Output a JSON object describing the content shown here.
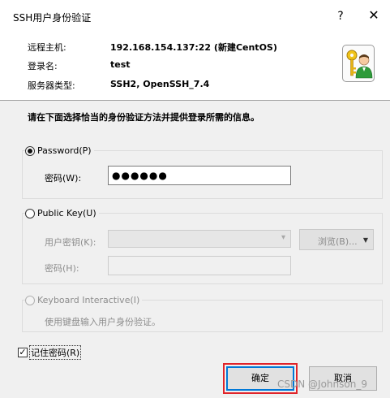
{
  "window": {
    "title": "SSH用户身份验证",
    "help": "?",
    "close": "✕"
  },
  "info": {
    "host_label": "远程主机:",
    "host_value": "192.168.154.137:22 (新建CentOS)",
    "login_label": "登录名:",
    "login_value": "test",
    "server_label": "服务器类型:",
    "server_value": "SSH2, OpenSSH_7.4"
  },
  "instruction": "请在下面选择恰当的身份验证方法并提供登录所需的信息。",
  "password_method": {
    "label": "Password(P)",
    "selected": true,
    "password_label": "密码(W):",
    "password_value": "●●●●●●"
  },
  "publickey_method": {
    "label": "Public Key(U)",
    "selected": false,
    "user_key_label": "用户密钥(K):",
    "user_key_value": "",
    "browse_label": "浏览(B)...",
    "passphrase_label": "密码(H):",
    "passphrase_value": ""
  },
  "keyboard_method": {
    "label": "Keyboard Interactive(I)",
    "selected": false,
    "description": "使用键盘输入用户身份验证。"
  },
  "remember": {
    "label": "记住密码(R)",
    "checked": true
  },
  "buttons": {
    "ok": "确定",
    "cancel": "取消"
  },
  "watermark": "CSDN @Johnson_9",
  "colors": {
    "highlight": "#e0242a",
    "default_button_border": "#0078d7"
  }
}
